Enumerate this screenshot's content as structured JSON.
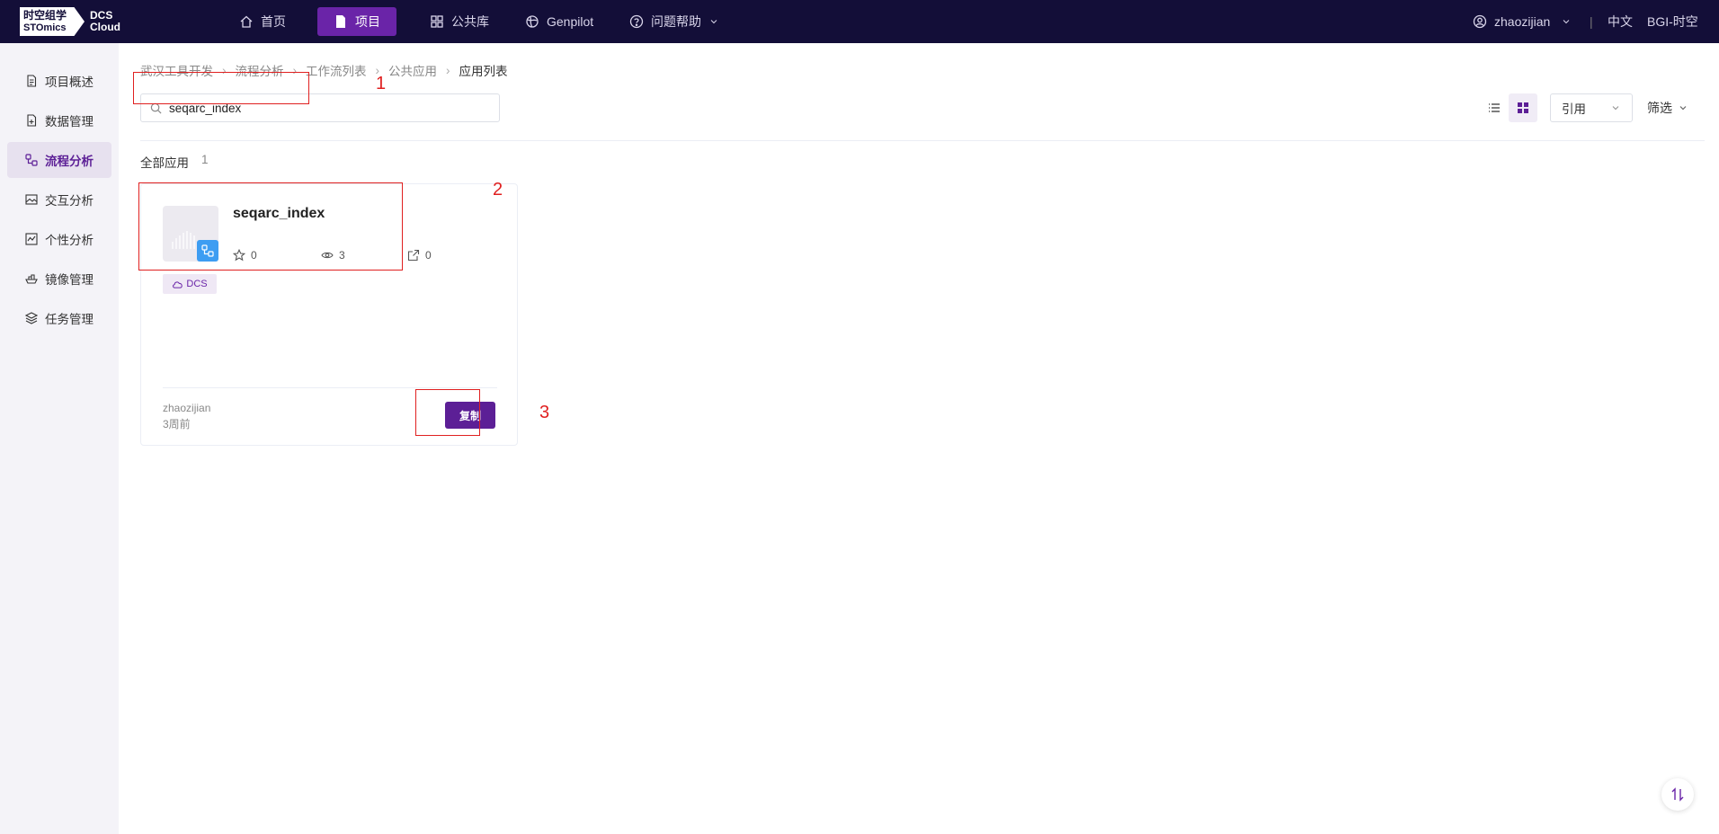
{
  "logo": {
    "line1": "时空组学",
    "line2": "STOmics",
    "product_line1": "DCS",
    "product_line2": "Cloud"
  },
  "nav": {
    "items": [
      {
        "label": "首页",
        "icon": "home-icon",
        "active": false
      },
      {
        "label": "项目",
        "icon": "document-icon",
        "active": true
      },
      {
        "label": "公共库",
        "icon": "grid-icon",
        "active": false
      },
      {
        "label": "Genpilot",
        "icon": "globe-icon",
        "active": false
      },
      {
        "label": "问题帮助",
        "icon": "help-icon",
        "active": false
      }
    ],
    "user": "zhaozijian",
    "language": "中文",
    "org": "BGI-时空"
  },
  "sidebar": {
    "items": [
      {
        "label": "项目概述",
        "icon": "file-icon"
      },
      {
        "label": "数据管理",
        "icon": "data-file-icon"
      },
      {
        "label": "流程分析",
        "icon": "workflow-icon"
      },
      {
        "label": "交互分析",
        "icon": "image-icon"
      },
      {
        "label": "个性分析",
        "icon": "chart-icon"
      },
      {
        "label": "镜像管理",
        "icon": "ship-icon"
      },
      {
        "label": "任务管理",
        "icon": "layers-icon"
      }
    ],
    "active_index": 2
  },
  "breadcrumb": [
    "武汉工具开发",
    "流程分析",
    "工作流列表",
    "公共应用",
    "应用列表"
  ],
  "search": {
    "value": "seqarc_index",
    "placeholder": ""
  },
  "sort": {
    "selected": "引用"
  },
  "filter_label": "筛选",
  "section": {
    "title": "全部应用",
    "count": "1"
  },
  "card": {
    "title": "seqarc_index",
    "stars": "0",
    "views": "3",
    "shares": "0",
    "tag": "DCS",
    "owner": "zhaozijian",
    "time": "3周前",
    "copy_label": "复制"
  },
  "annotations": [
    "1",
    "2",
    "3"
  ],
  "colors": {
    "topbar": "#130e38",
    "accent": "#5c1f96",
    "annotation": "#e02020"
  }
}
